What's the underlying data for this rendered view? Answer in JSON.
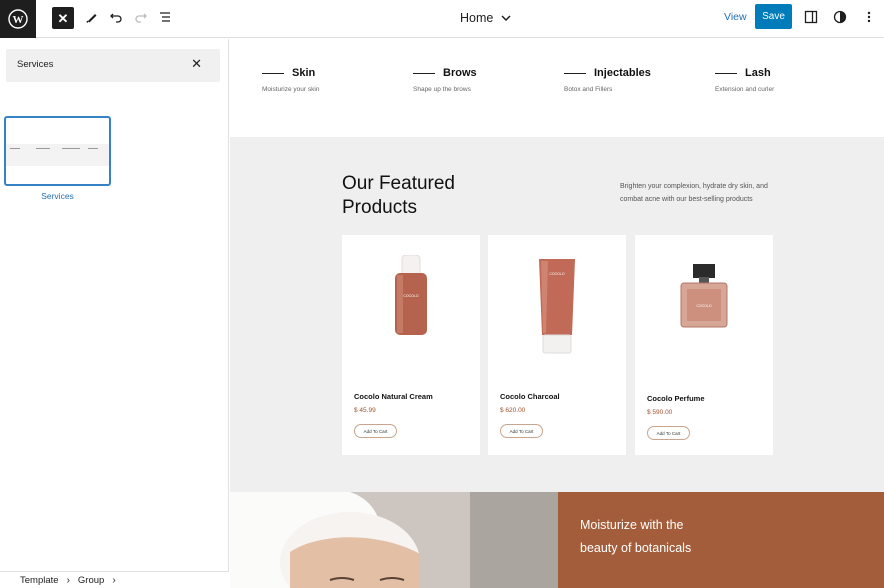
{
  "toolbar": {
    "doc_title": "Home",
    "view_label": "View",
    "save_label": "Save"
  },
  "sidebar": {
    "search_value": "Services",
    "pattern_label": "Services",
    "breadcrumbs": [
      "Template",
      "Group"
    ]
  },
  "services": [
    {
      "title": "Skin",
      "desc": "Moisturize your skin"
    },
    {
      "title": "Brows",
      "desc": "Shape up the brows"
    },
    {
      "title": "Injectables",
      "desc": "Botox and Fillers"
    },
    {
      "title": "Lash",
      "desc": "Extension and curler"
    }
  ],
  "featured": {
    "title": "Our Featured Products",
    "desc": "Brighten your complexion, hydrate dry skin, and combat acne with our best-selling products"
  },
  "products": [
    {
      "name": "Cocolo Natural Cream",
      "price": "$ 45.99",
      "cart": "Add To Cart"
    },
    {
      "name": "Cocolo Charcoal",
      "price": "$ 620.00",
      "cart": "Add To Cart"
    },
    {
      "name": "Cocolo Perfume",
      "price": "$ 590.00",
      "cart": "Add To Cart"
    }
  ],
  "hero": {
    "line1": "Moisturize with the",
    "line2": "beauty of botanicals"
  },
  "colors": {
    "accent": "#007cba",
    "brand_rust": "#a35d3b",
    "canvas_gray": "#efefef"
  }
}
